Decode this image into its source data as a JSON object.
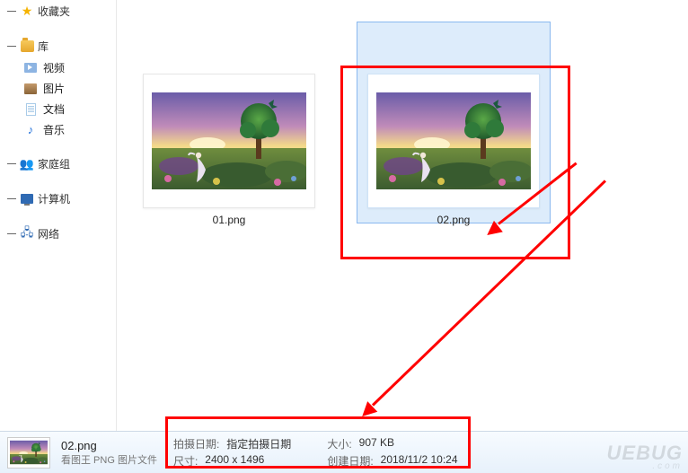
{
  "sidebar": {
    "favorites": {
      "label": "收藏夹"
    },
    "library": {
      "label": "库",
      "items": [
        {
          "label": "视频"
        },
        {
          "label": "图片"
        },
        {
          "label": "文档"
        },
        {
          "label": "音乐"
        }
      ]
    },
    "homegroup": {
      "label": "家庭组"
    },
    "computer": {
      "label": "计算机"
    },
    "network": {
      "label": "网络"
    }
  },
  "files": [
    {
      "name": "01.png"
    },
    {
      "name": "02.png"
    }
  ],
  "details": {
    "filename": "02.png",
    "filetype": "看图王 PNG 图片文件",
    "labels": {
      "date_taken": "拍摄日期:",
      "dimensions": "尺寸:",
      "size": "大小:",
      "date_created": "创建日期:"
    },
    "values": {
      "date_taken": "指定拍摄日期",
      "dimensions": "2400 x 1496",
      "size": "907 KB",
      "date_created": "2018/11/2 10:24"
    }
  },
  "watermark": {
    "main": "UEBUG",
    "sub": ".com"
  }
}
